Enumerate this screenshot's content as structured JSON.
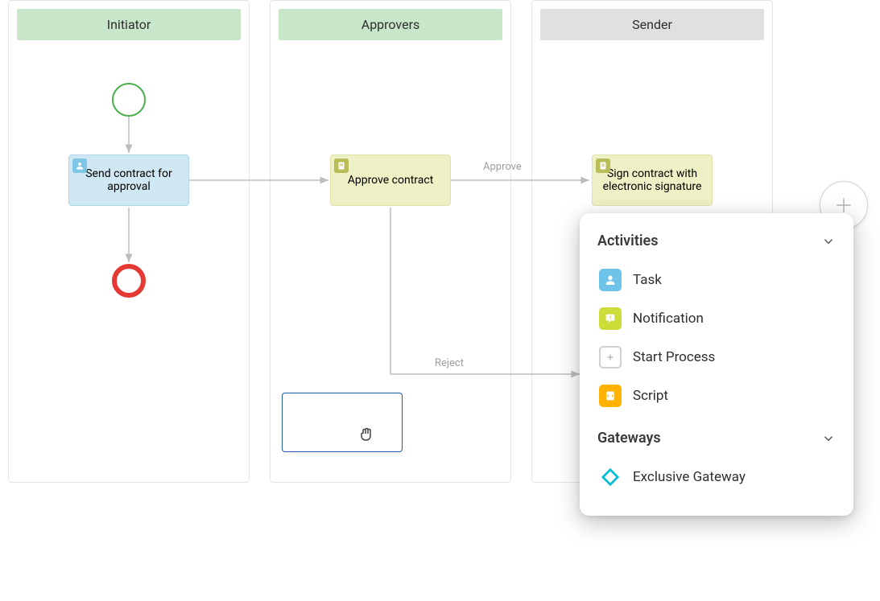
{
  "lanes": {
    "initiator": "Initiator",
    "approvers": "Approvers",
    "sender": "Sender"
  },
  "tasks": {
    "send_contract": "Send contract for approval",
    "approve_contract": "Approve contract",
    "sign_contract": "Sign contract with electronic signature"
  },
  "flows": {
    "approve": "Approve",
    "reject": "Reject"
  },
  "panel": {
    "sections": {
      "activities": "Activities",
      "gateways": "Gateways"
    },
    "items": {
      "task": "Task",
      "notification": "Notification",
      "start_process": "Start Process",
      "script": "Script",
      "exclusive_gateway": "Exclusive Gateway"
    }
  }
}
